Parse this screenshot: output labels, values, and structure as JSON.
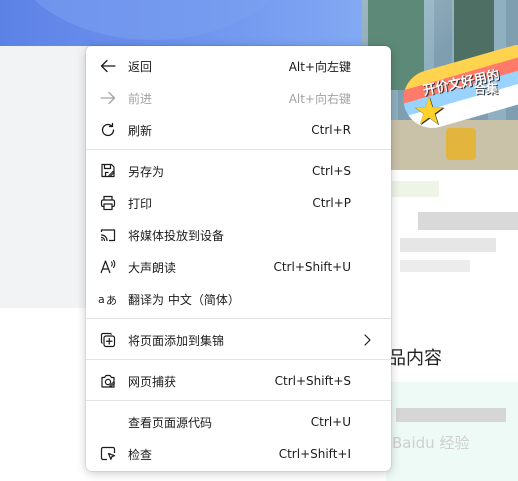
{
  "menu": {
    "items": [
      {
        "label": "返回",
        "shortcut": "Alt+向左键",
        "icon": "back-arrow-icon",
        "enabled": true
      },
      {
        "label": "前进",
        "shortcut": "Alt+向右键",
        "icon": "forward-arrow-icon",
        "enabled": false
      },
      {
        "label": "刷新",
        "shortcut": "Ctrl+R",
        "icon": "refresh-icon",
        "enabled": true
      },
      {
        "label": "另存为",
        "shortcut": "Ctrl+S",
        "icon": "save-as-icon",
        "enabled": true
      },
      {
        "label": "打印",
        "shortcut": "Ctrl+P",
        "icon": "printer-icon",
        "enabled": true
      },
      {
        "label": "将媒体投放到设备",
        "shortcut": "",
        "icon": "cast-icon",
        "enabled": true
      },
      {
        "label": "大声朗读",
        "shortcut": "Ctrl+Shift+U",
        "icon": "read-aloud-icon",
        "enabled": true
      },
      {
        "label": "翻译为 中文（简体）",
        "shortcut": "",
        "icon": "translate-icon",
        "enabled": true
      },
      {
        "label": "将页面添加到集锦",
        "shortcut": "",
        "icon": "collections-icon",
        "enabled": true,
        "submenu": true
      },
      {
        "label": "网页捕获",
        "shortcut": "Ctrl+Shift+S",
        "icon": "web-capture-icon",
        "enabled": true
      },
      {
        "label": "查看页面源代码",
        "shortcut": "Ctrl+U",
        "icon": "",
        "enabled": true
      },
      {
        "label": "检查",
        "shortcut": "Ctrl+Shift+I",
        "icon": "inspect-icon",
        "enabled": true
      }
    ]
  },
  "background": {
    "photo_caption_line1": "开价文好用的",
    "photo_caption_line2": "合集",
    "section_title": "品内容",
    "watermark": "Baidu 经验"
  },
  "colors": {
    "menu_text": "#1b1b1b",
    "menu_disabled": "#a3a3a3",
    "banner_blue": "#6f95ef",
    "separator": "#e3e3e3"
  }
}
